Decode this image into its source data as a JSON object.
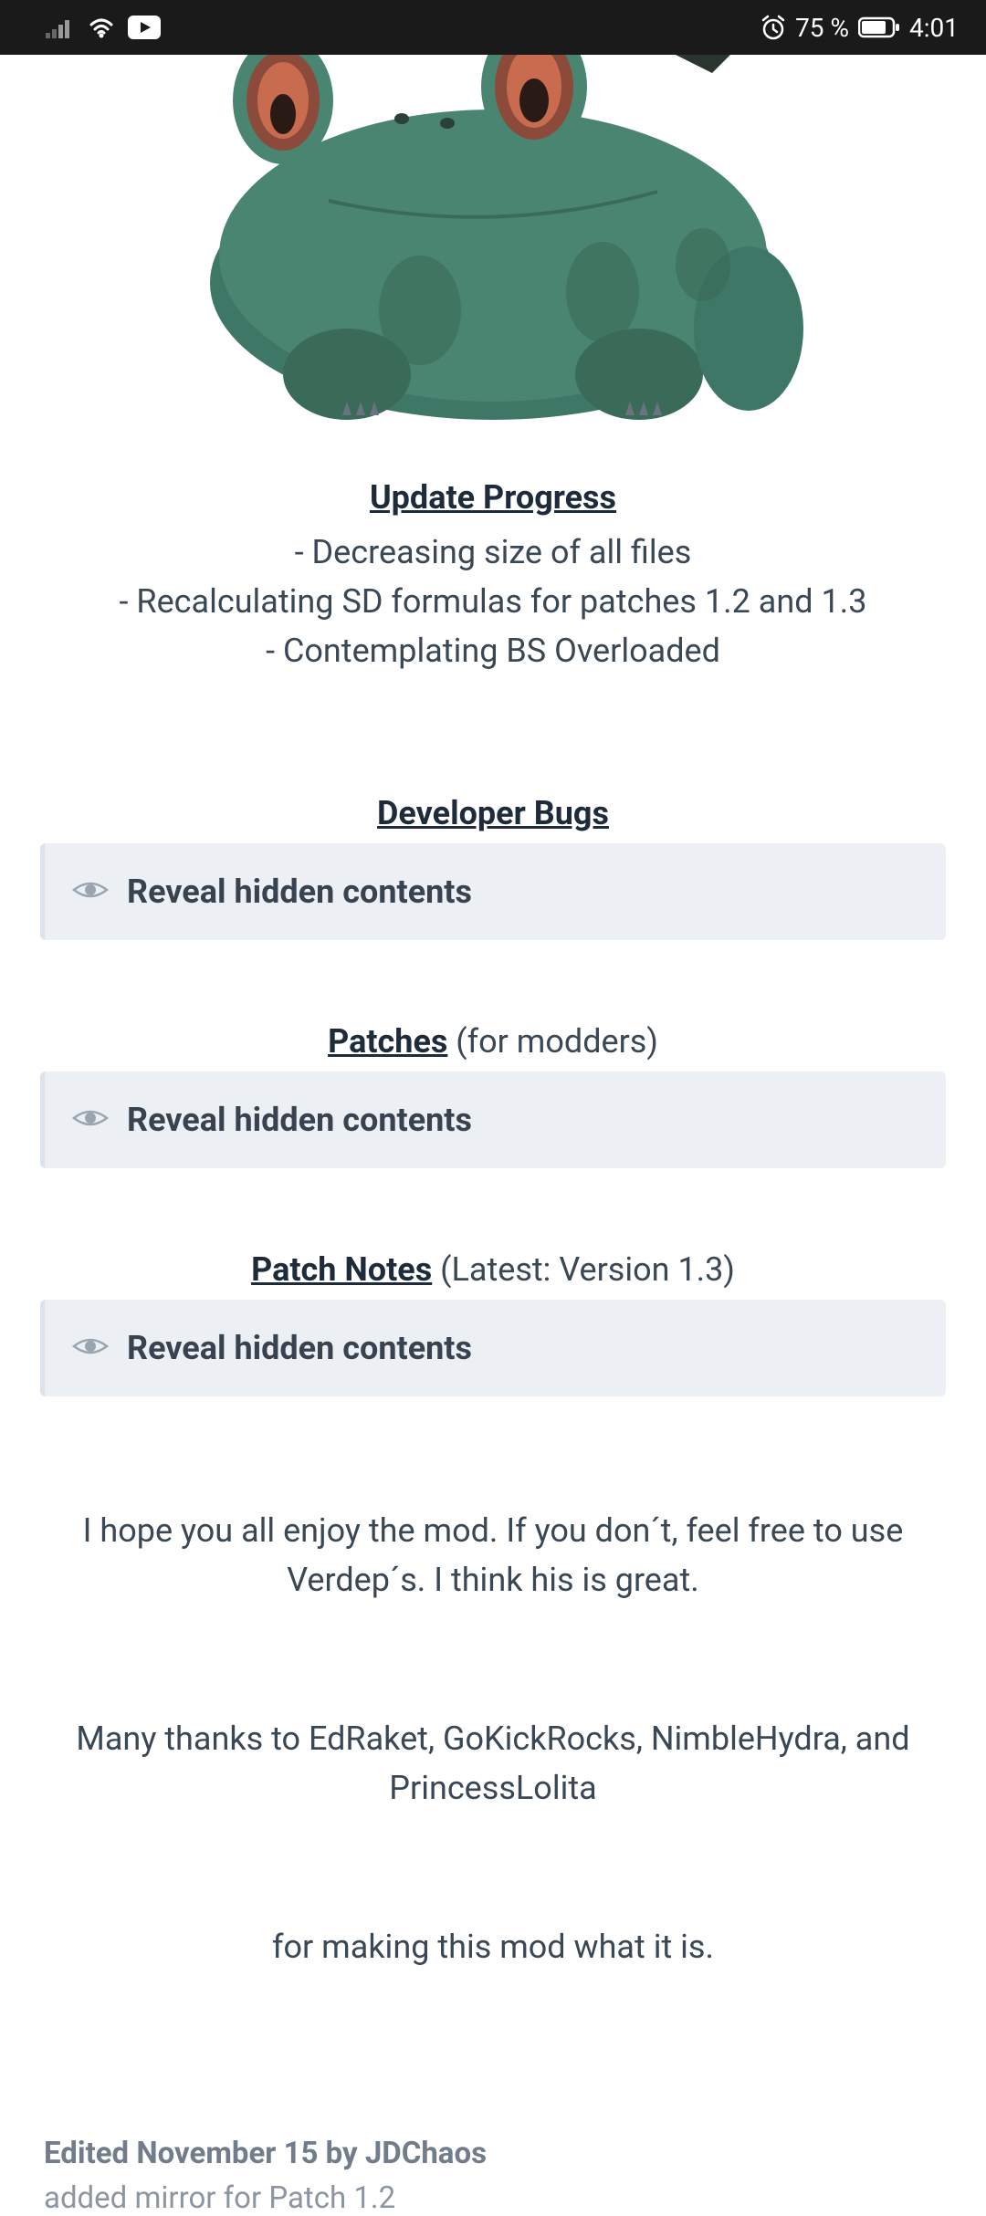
{
  "statusbar": {
    "battery_text": "75 %",
    "time": "4:01"
  },
  "post": {
    "update_progress": {
      "title": "Update Progress",
      "items": [
        "- Decreasing size of all files",
        "- Recalculating SD formulas for patches 1.2 and 1.3",
        "- Contemplating BS Overloaded"
      ]
    },
    "dev_bugs": {
      "title": "Developer Bugs"
    },
    "patches": {
      "title": "Patches",
      "suffix": " (for modders)"
    },
    "patch_notes": {
      "title": "Patch Notes",
      "suffix": " (Latest: Version 1.3)"
    },
    "spoiler_label": "Reveal hidden contents",
    "closing1": "I hope you all enjoy the mod. If you don´t, feel free to use Verdep´s. I think his is great.",
    "closing2": "Many thanks to EdRaket, GoKickRocks, NimbleHydra, and PrincessLolita",
    "closing3": "for making this mod what it is.",
    "edited": "Edited November 15 by JDChaos",
    "edit_reason": "added mirror for Patch 1.2"
  }
}
